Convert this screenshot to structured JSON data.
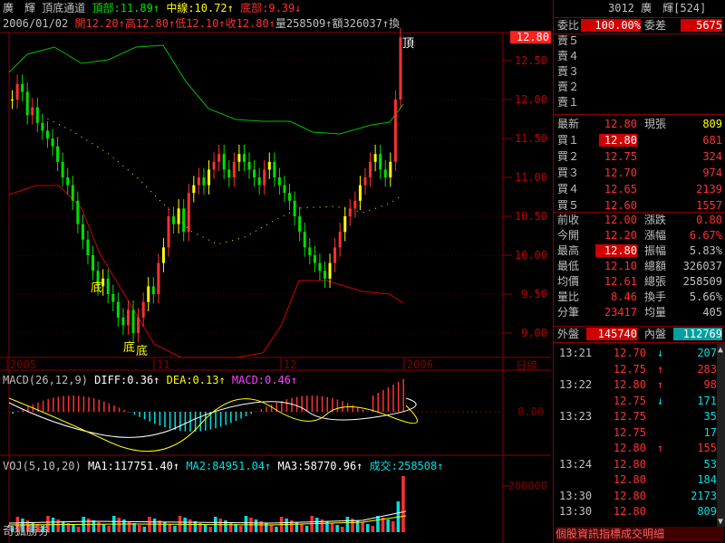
{
  "app": {
    "watermark": "奇狐勝券",
    "bottom_ticker": "個股資訊指標成交明細"
  },
  "indicator": {
    "stock_name": "廣　輝",
    "name": "頂底通道",
    "top_label": "頂部:11.89↑",
    "mid_label": "中線:10.72↑",
    "bottom_label": "底部:9.39↓"
  },
  "bar_info": {
    "date": "2006/01/02",
    "open": "開12.20↑",
    "high": "高12.80↑",
    "low": "低12.10↑",
    "close": "收12.80↑",
    "volume": "量258509↑",
    "amount": "額326037↑",
    "turnover": "換"
  },
  "price_axis": {
    "ticks": [
      "12.50",
      "12.00",
      "11.50",
      "11.00",
      "10.50",
      "10.00",
      "9.50",
      "9.00"
    ],
    "current": "12.80"
  },
  "chart_markers": {
    "top": "頂",
    "bottom1": "底",
    "bottom2": "底"
  },
  "time_axis": {
    "labels": [
      "2005",
      "11",
      "12",
      "2006"
    ],
    "period": "日線"
  },
  "macd": {
    "title": "MACD(26,12,9)",
    "diff": "DIFF:0.36↑",
    "dea": "DEA:0.13↑",
    "macd": "MACD:0.46↑",
    "axis": "0.00"
  },
  "vol": {
    "title": "VOJ(5,10,20)",
    "ma1": "MA1:117751.40↑",
    "ma2": "MA2:84951.04↑",
    "ma3": "MA3:58770.96↑",
    "volume": "成交:258508↑",
    "axis": "200000"
  },
  "colors": {
    "up": "#ff3030",
    "down": "#00e000",
    "yellow": "#ffff00",
    "cyan": "#00e0e0",
    "magenta": "#ff40ff",
    "grid": "#8b0000",
    "panel_text": "#c0c0c0"
  },
  "quote": {
    "code_name": "3012 廣　輝[524]",
    "weibi_label": "委比",
    "weibi_value": "100.00%",
    "weicha_label": "委差",
    "weicha_value": "5675",
    "sells": [
      {
        "label": "賣５",
        "price": "",
        "vol": ""
      },
      {
        "label": "賣４",
        "price": "",
        "vol": ""
      },
      {
        "label": "賣３",
        "price": "",
        "vol": ""
      },
      {
        "label": "賣２",
        "price": "",
        "vol": ""
      },
      {
        "label": "賣１",
        "price": "",
        "vol": ""
      }
    ],
    "last": {
      "label": "最新",
      "price": "12.80",
      "vol_label": "現張",
      "vol": "809"
    },
    "buys": [
      {
        "label": "買１",
        "price": "12.80",
        "vol": "681"
      },
      {
        "label": "買２",
        "price": "12.75",
        "vol": "324"
      },
      {
        "label": "買３",
        "price": "12.70",
        "vol": "974"
      },
      {
        "label": "買４",
        "price": "12.65",
        "vol": "2139"
      },
      {
        "label": "買５",
        "price": "12.60",
        "vol": "1557"
      }
    ],
    "stats": [
      {
        "l1": "前收",
        "v1": "12.00",
        "l2": "漲跌",
        "v2": "0.80"
      },
      {
        "l1": "今開",
        "v1": "12.20",
        "l2": "漲幅",
        "v2": "6.67%"
      },
      {
        "l1": "最高",
        "v1": "12.80",
        "l2": "振幅",
        "v2": "5.83%"
      },
      {
        "l1": "最低",
        "v1": "12.10",
        "l2": "總額",
        "v2": "326037"
      },
      {
        "l1": "均價",
        "v1": "12.61",
        "l2": "總張",
        "v2": "258509"
      },
      {
        "l1": "量比",
        "v1": "8.46",
        "l2": "換手",
        "v2": "5.66%"
      },
      {
        "l1": "分筆",
        "v1": "23417",
        "l2": "均量",
        "v2": "405"
      }
    ],
    "outer_label": "外盤",
    "outer_value": "145740",
    "inner_label": "內盤",
    "inner_value": "112769",
    "ticks": [
      {
        "time": "13:21",
        "price": "12.70",
        "dir": "↓",
        "vol": "207"
      },
      {
        "time": "",
        "price": "12.75",
        "dir": "↑",
        "vol": "283"
      },
      {
        "time": "13:22",
        "price": "12.80",
        "dir": "↑",
        "vol": "98"
      },
      {
        "time": "",
        "price": "12.75",
        "dir": "↓",
        "vol": "171"
      },
      {
        "time": "13:23",
        "price": "12.75",
        "dir": "",
        "vol": "35"
      },
      {
        "time": "",
        "price": "12.75",
        "dir": "",
        "vol": "17"
      },
      {
        "time": "",
        "price": "12.80",
        "dir": "↑",
        "vol": "155"
      },
      {
        "time": "13:24",
        "price": "12.80",
        "dir": "",
        "vol": "53"
      },
      {
        "time": "",
        "price": "12.80",
        "dir": "",
        "vol": "184"
      },
      {
        "time": "13:30",
        "price": "12.80",
        "dir": "",
        "vol": "2173"
      },
      {
        "time": "13:30",
        "price": "12.80",
        "dir": "",
        "vol": "809"
      }
    ]
  }
}
